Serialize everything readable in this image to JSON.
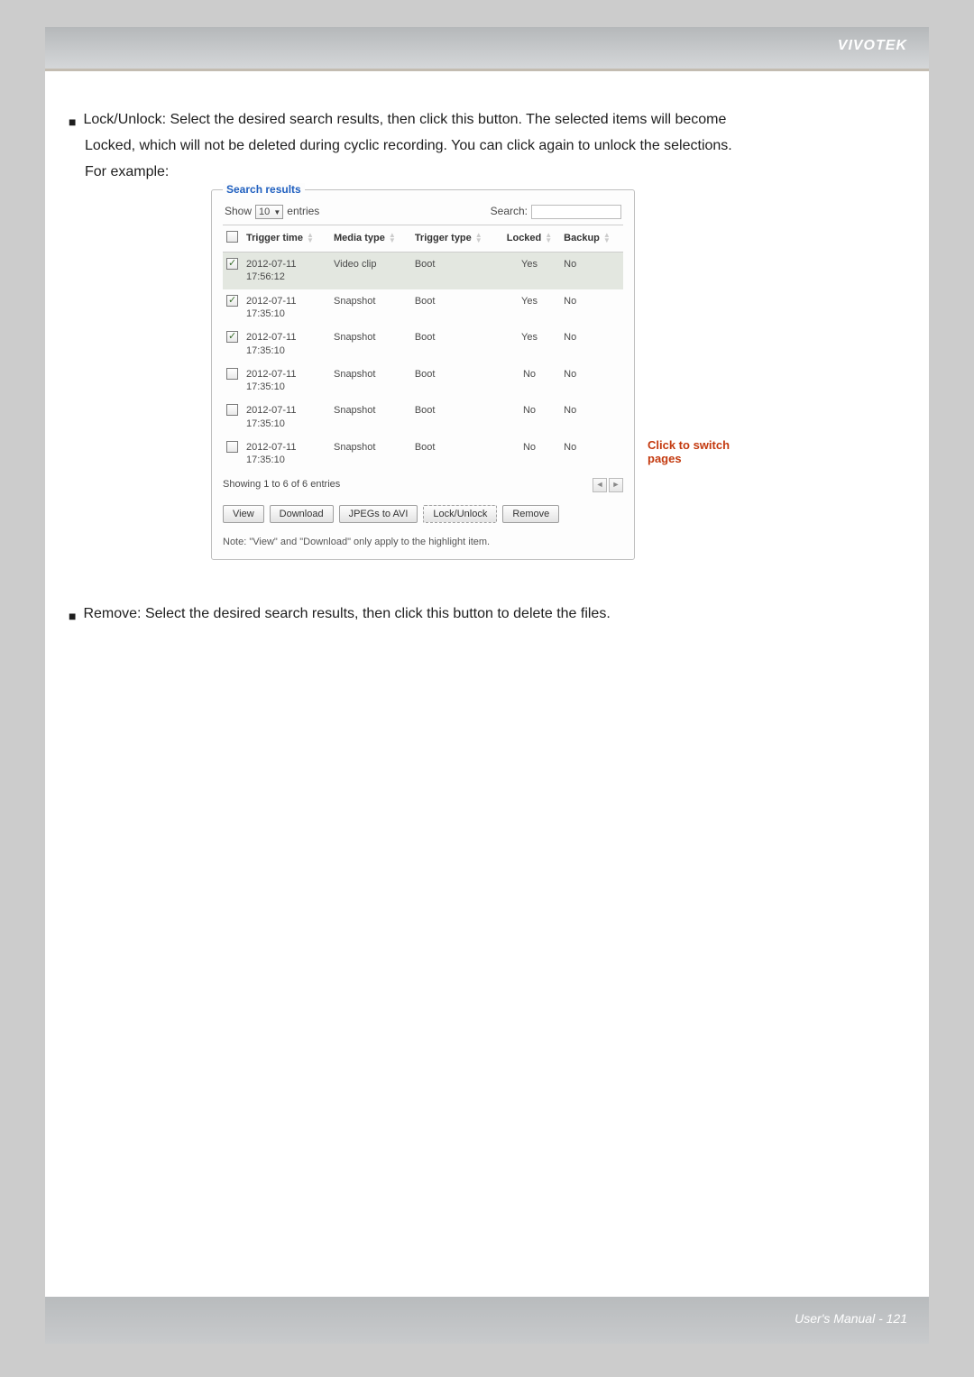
{
  "brand": "VIVOTEK",
  "footer": "User's Manual - 121",
  "body": {
    "lock": {
      "lead": "Lock/Unlock: Select the desired search results, then click this button. The selected items will become",
      "l2": "Locked, which will not be deleted during cyclic recording. You can click again to unlock the selections.",
      "l3": "For example:"
    },
    "remove": "Remove: Select the desired search results, then click this button to delete the files.",
    "callout": "Click to switch pages"
  },
  "panel": {
    "title": "Search results",
    "show": "Show",
    "entries": "entries",
    "entries_val": "10",
    "search": "Search:",
    "headers": {
      "trigger_time": "Trigger time",
      "media_type": "Media type",
      "trigger_type": "Trigger type",
      "locked": "Locked",
      "backup": "Backup"
    },
    "rows": [
      {
        "chk": true,
        "sel": true,
        "d": "2012-07-11",
        "t": "17:56:12",
        "mt": "Video clip",
        "tt": "Boot",
        "lk": "Yes",
        "bk": "No"
      },
      {
        "chk": true,
        "sel": false,
        "d": "2012-07-11",
        "t": "17:35:10",
        "mt": "Snapshot",
        "tt": "Boot",
        "lk": "Yes",
        "bk": "No"
      },
      {
        "chk": true,
        "sel": false,
        "d": "2012-07-11",
        "t": "17:35:10",
        "mt": "Snapshot",
        "tt": "Boot",
        "lk": "Yes",
        "bk": "No"
      },
      {
        "chk": false,
        "sel": false,
        "d": "2012-07-11",
        "t": "17:35:10",
        "mt": "Snapshot",
        "tt": "Boot",
        "lk": "No",
        "bk": "No"
      },
      {
        "chk": false,
        "sel": false,
        "d": "2012-07-11",
        "t": "17:35:10",
        "mt": "Snapshot",
        "tt": "Boot",
        "lk": "No",
        "bk": "No"
      },
      {
        "chk": false,
        "sel": false,
        "d": "2012-07-11",
        "t": "17:35:10",
        "mt": "Snapshot",
        "tt": "Boot",
        "lk": "No",
        "bk": "No"
      }
    ],
    "showing": "Showing 1 to 6 of 6 entries",
    "buttons": {
      "view": "View",
      "download": "Download",
      "jpegs": "JPEGs to AVI",
      "lock": "Lock/Unlock",
      "remove": "Remove"
    },
    "note": "Note: \"View\" and \"Download\" only apply to the highlight item."
  }
}
